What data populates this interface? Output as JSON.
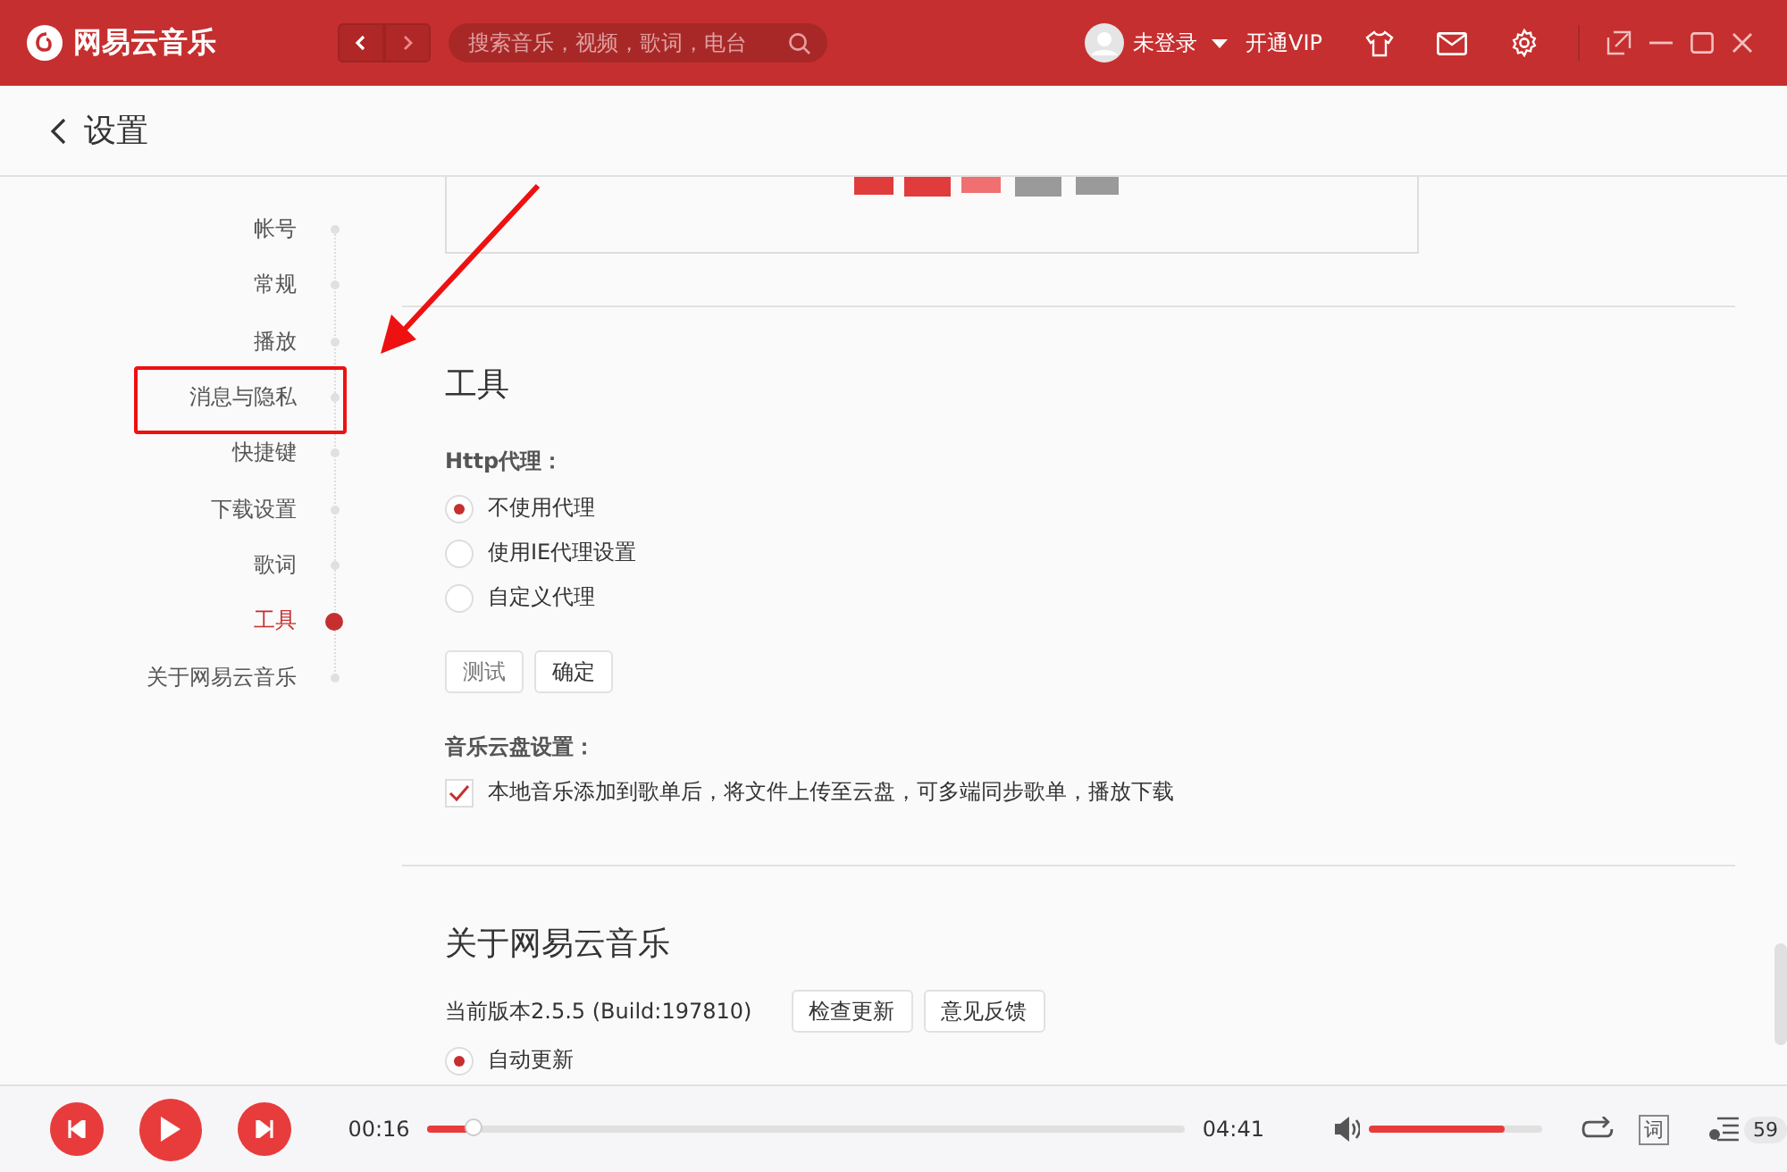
{
  "titlebar": {
    "app_name": "网易云音乐",
    "search": {
      "placeholder": "搜索音乐，视频，歌词，电台"
    },
    "user": "未登录",
    "vip": "开通VIP"
  },
  "page": {
    "title": "设置"
  },
  "nav": [
    {
      "label": "帐号",
      "selected": false,
      "highlighted": false
    },
    {
      "label": "常规",
      "selected": false,
      "highlighted": false
    },
    {
      "label": "播放",
      "selected": false,
      "highlighted": false
    },
    {
      "label": "消息与隐私",
      "selected": false,
      "highlighted": true
    },
    {
      "label": "快捷键",
      "selected": false,
      "highlighted": false
    },
    {
      "label": "下载设置",
      "selected": false,
      "highlighted": false
    },
    {
      "label": "歌词",
      "selected": false,
      "highlighted": false
    },
    {
      "label": "工具",
      "selected": true,
      "highlighted": false
    },
    {
      "label": "关于网易云音乐",
      "selected": false,
      "highlighted": false
    }
  ],
  "tools": {
    "title": "工具",
    "proxy_label": "Http代理：",
    "proxy_options": [
      {
        "label": "不使用代理",
        "selected": true
      },
      {
        "label": "使用IE代理设置",
        "selected": false
      },
      {
        "label": "自定义代理",
        "selected": false
      }
    ],
    "buttons": [
      "测试",
      "确定"
    ],
    "cloud_label": "音乐云盘设置：",
    "cloud_option": {
      "label": "本地音乐添加到歌单后，将文件上传至云盘，可多端同步歌单，播放下载",
      "checked": true
    }
  },
  "about": {
    "title": "关于网易云音乐",
    "version": "当前版本2.5.5 (Build:197810)",
    "buttons": [
      "检查更新",
      "意见反馈"
    ],
    "update_options": [
      {
        "label": "自动更新",
        "selected": true
      }
    ]
  },
  "player": {
    "elapsed": "00:16",
    "duration": "04:41",
    "progress": {
      "level": 0.06
    },
    "volume": {
      "level": 0.78
    },
    "lyric_button": "词",
    "playlist_count": "59"
  }
}
